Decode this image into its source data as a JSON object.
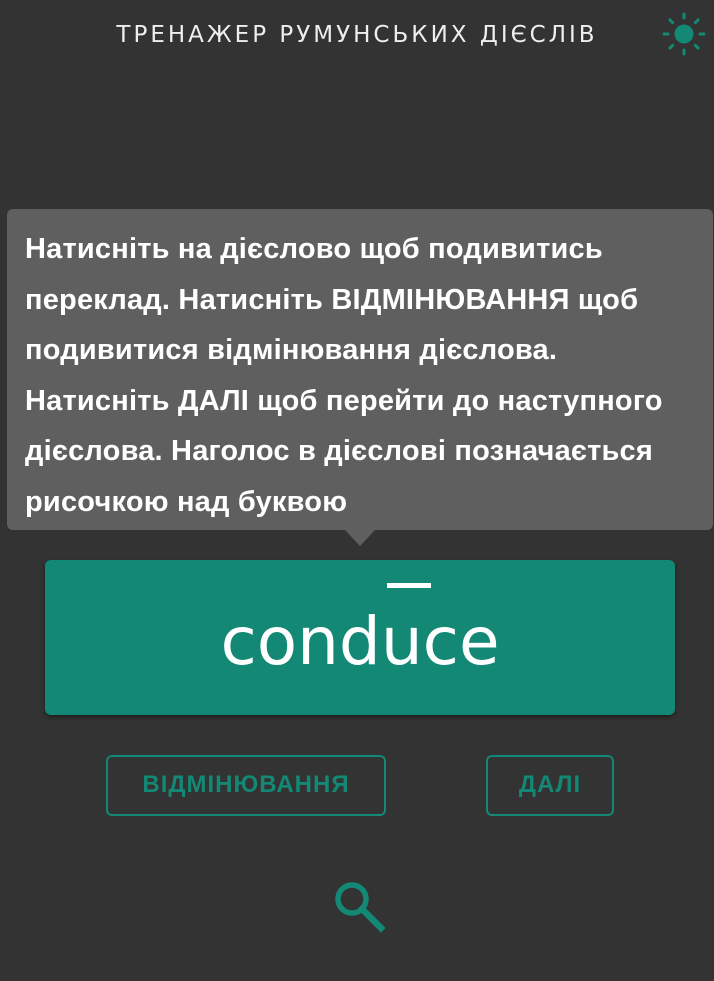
{
  "header": {
    "title": "ТРЕНАЖЕР РУМУНСЬКИХ ДІЄСЛІВ",
    "theme_icon": "sun-icon"
  },
  "tooltip": {
    "text": "Натисніть на дієслово щоб подивитись переклад. Натисніть ВІДМІНЮВАННЯ щоб подивитися відмінювання дієслова. Натисніть ДАЛІ щоб перейти до наступного дієслова. Наголос в дієслові позначається рисочкою над буквою"
  },
  "verb": {
    "word": "conduce",
    "stressed_letter": "u"
  },
  "actions": {
    "conjugation_label": "ВІДМІНЮВАННЯ",
    "next_label": "ДАЛІ"
  },
  "search": {
    "icon": "search-icon"
  },
  "colors": {
    "background": "#333333",
    "accent": "#128875",
    "tooltip_background": "#5f5f5f",
    "text": "#ffffff"
  }
}
